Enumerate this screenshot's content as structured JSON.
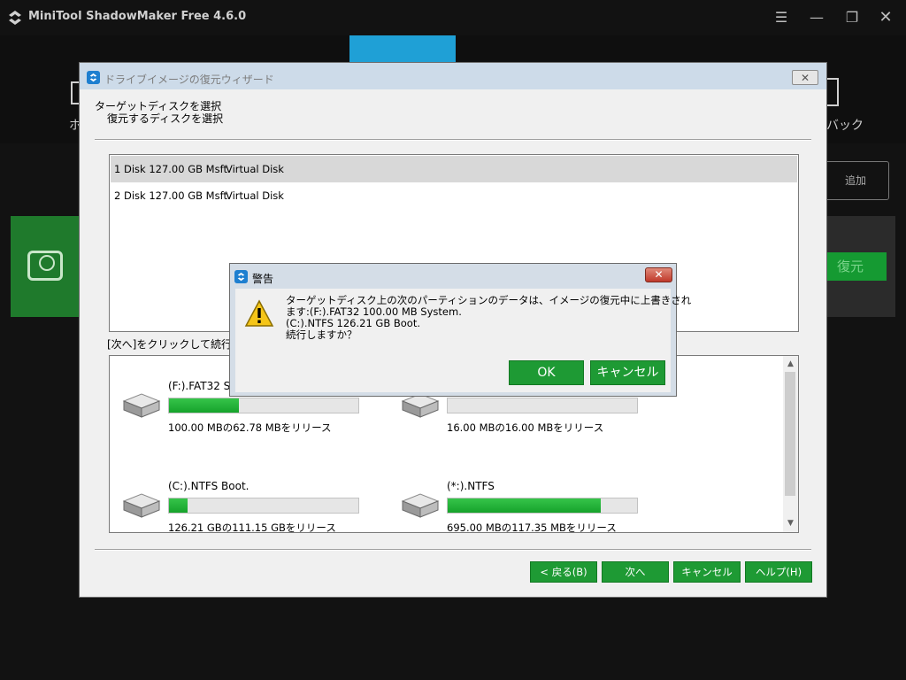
{
  "app": {
    "title": "MiniTool ShadowMaker Free 4.6.0",
    "nav_left_label": "ホ",
    "nav_right_label": "バック",
    "add_button_label": "追加",
    "restore_button_label": "復元",
    "controls": {
      "menu": "menu-icon",
      "minimize": "minimize-icon",
      "restore": "restore-window-icon",
      "close": "close-icon"
    }
  },
  "wizard": {
    "title": "ドライブイメージの復元ウィザード",
    "heading": "ターゲットディスクを選択",
    "subheading": "復元するディスクを選択",
    "disks": [
      {
        "name": "1 Disk 127.00 GB Msft",
        "type": "Virtual Disk",
        "selected": true
      },
      {
        "name": "2 Disk 127.00 GB Msft",
        "type": "Virtual Disk",
        "selected": false
      }
    ],
    "instruction": "[次へ]をクリックして続行しま",
    "partitions": [
      {
        "name": "(F:).FAT32 S",
        "free_text": "100.00 MBの62.78 MBをリリース",
        "used_fraction": 0.37
      },
      {
        "name": "",
        "free_text": "16.00 MBの16.00 MBをリリース",
        "used_fraction": 0.0
      },
      {
        "name": "(C:).NTFS Boot.",
        "free_text": "126.21 GBの111.15 GBをリリース",
        "used_fraction": 0.1
      },
      {
        "name": "(*:).NTFS",
        "free_text": "695.00 MBの117.35 MBをリリース",
        "used_fraction": 0.81
      }
    ],
    "buttons": {
      "back": "< 戻る(B)",
      "next": "次へ",
      "cancel": "キャンセル",
      "help": "ヘルプ(H)"
    }
  },
  "warning": {
    "title": "警告",
    "message_lines": [
      "ターゲットディスク上の次のパーティションのデータは、イメージの復元中に上書きされ",
      "ます:(F:).FAT32 100.00 MB System.",
      "(C:).NTFS 126.21 GB Boot.",
      "続行しますか？"
    ],
    "ok_label": "OK",
    "cancel_label": "キャンセル"
  },
  "colors": {
    "accent_green": "#1e9a34",
    "progress_green": "#16a32b",
    "app_bg": "#121212",
    "nav_highlight": "#1fa0d6"
  }
}
